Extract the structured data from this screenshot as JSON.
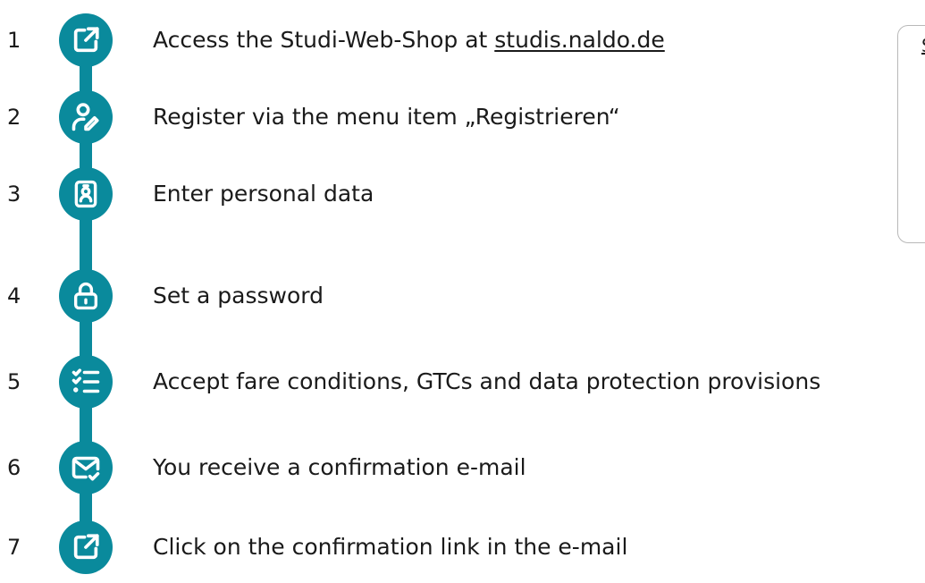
{
  "steps": [
    {
      "number": "1",
      "icon": "external-link-icon",
      "text_before": "Access the Studi-Web-Shop at ",
      "link": "studis.naldo.de",
      "text": ""
    },
    {
      "number": "2",
      "icon": "user-edit-icon",
      "text": "Register via the menu item „Registrieren“"
    },
    {
      "number": "3",
      "icon": "id-badge-icon",
      "text": "Enter personal data"
    },
    {
      "number": "4",
      "icon": "lock-icon",
      "text": "Set a password"
    },
    {
      "number": "5",
      "icon": "checklist-icon",
      "text": "Accept fare conditions, GTCs and data protection provisions"
    },
    {
      "number": "6",
      "icon": "mail-check-icon",
      "text": "You receive a confirmation e-mail"
    },
    {
      "number": "7",
      "icon": "external-link-icon",
      "text": "Click on the confirmation link in the e-mail"
    }
  ],
  "side_box": {
    "text": "S"
  },
  "colors": {
    "accent": "#0a8a9c",
    "text": "#1a1a1a",
    "box_border": "#b9b9b9"
  }
}
